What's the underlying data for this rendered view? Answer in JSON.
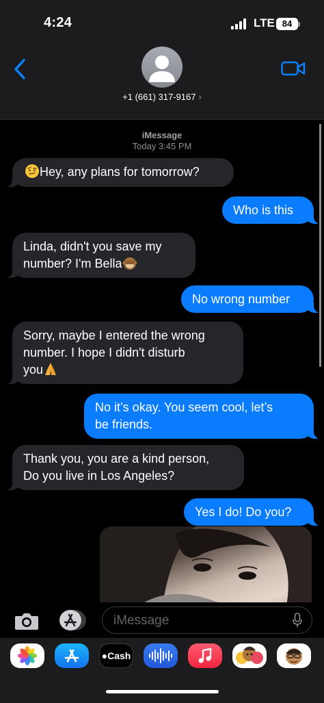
{
  "status": {
    "time": "4:24",
    "network": "LTE",
    "battery": "84"
  },
  "header": {
    "contact": "+1 (661) 317-9167",
    "chevron": "›"
  },
  "conversation": {
    "service": "iMessage",
    "timestamp": "Today 3:45 PM",
    "messages": [
      {
        "from": "them",
        "emoji": "face-with-raised-eyebrow",
        "lines": [
          "Hey, any plans for tomorrow?"
        ]
      },
      {
        "from": "me",
        "lines": [
          "Who is this"
        ]
      },
      {
        "from": "them",
        "emoji": "see-no-evil-monkey",
        "lines": [
          "Linda, didn't you save my",
          "number? I'm Bella"
        ]
      },
      {
        "from": "me",
        "lines": [
          "No wrong number"
        ]
      },
      {
        "from": "them",
        "emoji": "folded-hands",
        "lines": [
          "Sorry, maybe I entered the wrong",
          "number. I hope I didn't disturb",
          "you"
        ]
      },
      {
        "from": "me",
        "lines": [
          "No it’s okay. You seem cool, let’s",
          "be friends."
        ]
      },
      {
        "from": "them",
        "lines": [
          "Thank you, you are a kind person,",
          "Do you live in Los Angeles?"
        ]
      },
      {
        "from": "me",
        "lines": [
          "Yes I do! Do you?"
        ]
      },
      {
        "from": "them",
        "type": "photo",
        "subject": "selfie-photo"
      }
    ]
  },
  "input": {
    "placeholder": "iMessage"
  },
  "drawer": {
    "apps": [
      {
        "name": "photos-icon"
      },
      {
        "name": "app-store-icon"
      },
      {
        "name": "cash-icon",
        "label": "Cash"
      },
      {
        "name": "audio-message-icon"
      },
      {
        "name": "music-icon"
      },
      {
        "name": "memoji-icon"
      },
      {
        "name": "memoji-stickers-icon"
      }
    ]
  },
  "colors": {
    "incoming": "#26252a",
    "outgoing": "#0a7cff",
    "background": "#000000",
    "header": "#1c1c1e"
  }
}
